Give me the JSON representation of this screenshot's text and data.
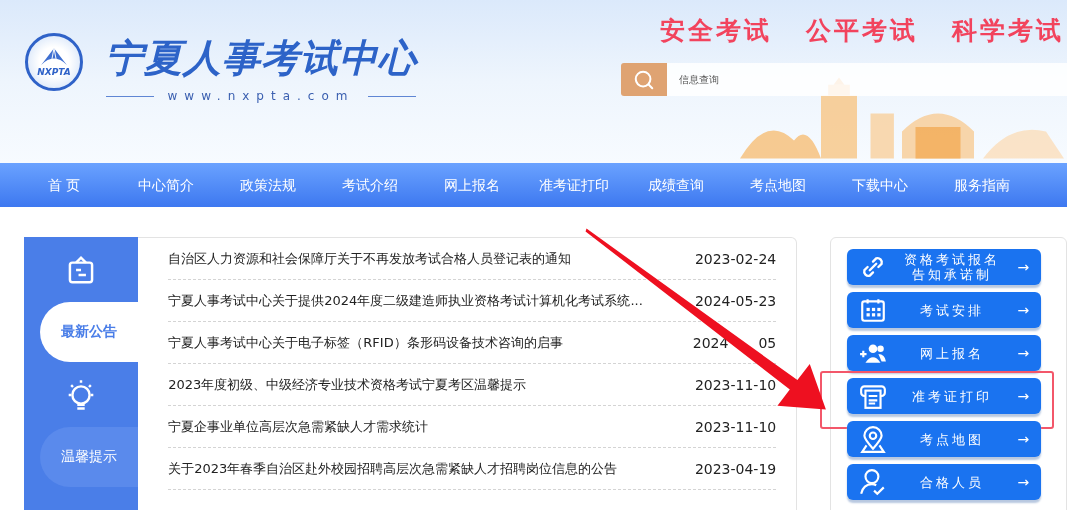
{
  "header": {
    "site_title": "宁夏人事考试中心",
    "logo_text": "NXPTA",
    "url": "www.nxpta.com",
    "slogans": [
      "安全考试",
      "公平考试",
      "科学考试"
    ],
    "search": {
      "placeholder": "信息查询"
    }
  },
  "nav": {
    "items": [
      {
        "label": "首 页"
      },
      {
        "label": "中心简介"
      },
      {
        "label": "政策法规"
      },
      {
        "label": "考试介绍"
      },
      {
        "label": "网上报名"
      },
      {
        "label": "准考证打印"
      },
      {
        "label": "成绩查询"
      },
      {
        "label": "考点地图"
      },
      {
        "label": "下载中心"
      },
      {
        "label": "服务指南"
      }
    ]
  },
  "sidebar": {
    "tabs": [
      {
        "label": "最新公告",
        "selected": true
      },
      {
        "label": "温馨提示",
        "selected": false
      }
    ]
  },
  "notices": [
    {
      "title": "自治区人力资源和社会保障厅关于不再发放考试合格人员登记表的通知",
      "date": "2023-02-24"
    },
    {
      "title": "宁夏人事考试中心关于提供2024年度二级建造师执业资格考试计算机化考试系统...",
      "date": "2024-05-23"
    },
    {
      "title": "宁夏人事考试中心关于电子标签（RFID）条形码设备技术咨询的启事",
      "date": "2024",
      "date_tail": "05"
    },
    {
      "title": "2023年度初级、中级经济专业技术资格考试宁夏考区温馨提示",
      "date": "2023-11-10"
    },
    {
      "title": "宁夏企事业单位高层次急需紧缺人才需求统计",
      "date": "2023-11-10"
    },
    {
      "title": "关于2023年春季自治区赴外校园招聘高层次急需紧缺人才招聘岗位信息的公告",
      "date": "2023-04-19"
    }
  ],
  "quick_links": [
    {
      "kind": "link",
      "lines": [
        "资格考试报名",
        "告知承诺制"
      ],
      "highlighted": false
    },
    {
      "kind": "calendar",
      "lines": [
        "考试安排"
      ],
      "highlighted": false
    },
    {
      "kind": "users",
      "lines": [
        "网上报名"
      ],
      "highlighted": false
    },
    {
      "kind": "printer",
      "lines": [
        "准考证打印"
      ],
      "highlighted": true
    },
    {
      "kind": "pin",
      "lines": [
        "考点地图"
      ],
      "highlighted": false
    },
    {
      "kind": "person",
      "lines": [
        "合格人员"
      ],
      "highlighted": false
    }
  ],
  "arrow_icon": "→"
}
